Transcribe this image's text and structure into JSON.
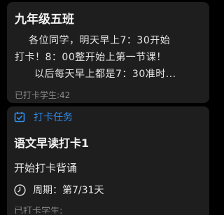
{
  "group_card": {
    "title": "九年级五班",
    "message_lines": [
      "各位同学，明天早上7：30开始",
      "打卡！8：00整开始上第一节课！",
      "以后每天早上都是7：30准时..."
    ],
    "signed_count": "已打卡学生:42"
  },
  "task_card": {
    "header_label": "打卡任务",
    "header_icon": "checkbox-calendar-icon",
    "title": "语文早读打卡1",
    "description": "开始打卡背诵",
    "period_icon": "clock-icon",
    "period_text": "周期：第7/31天",
    "partial_text": "已打卡学生:"
  },
  "colors": {
    "background": "#000000",
    "card": "#1e1e1e",
    "accent": "#2f8cf0",
    "primary_text": "#f2f2f2",
    "secondary_text": "#8a8a8a"
  }
}
